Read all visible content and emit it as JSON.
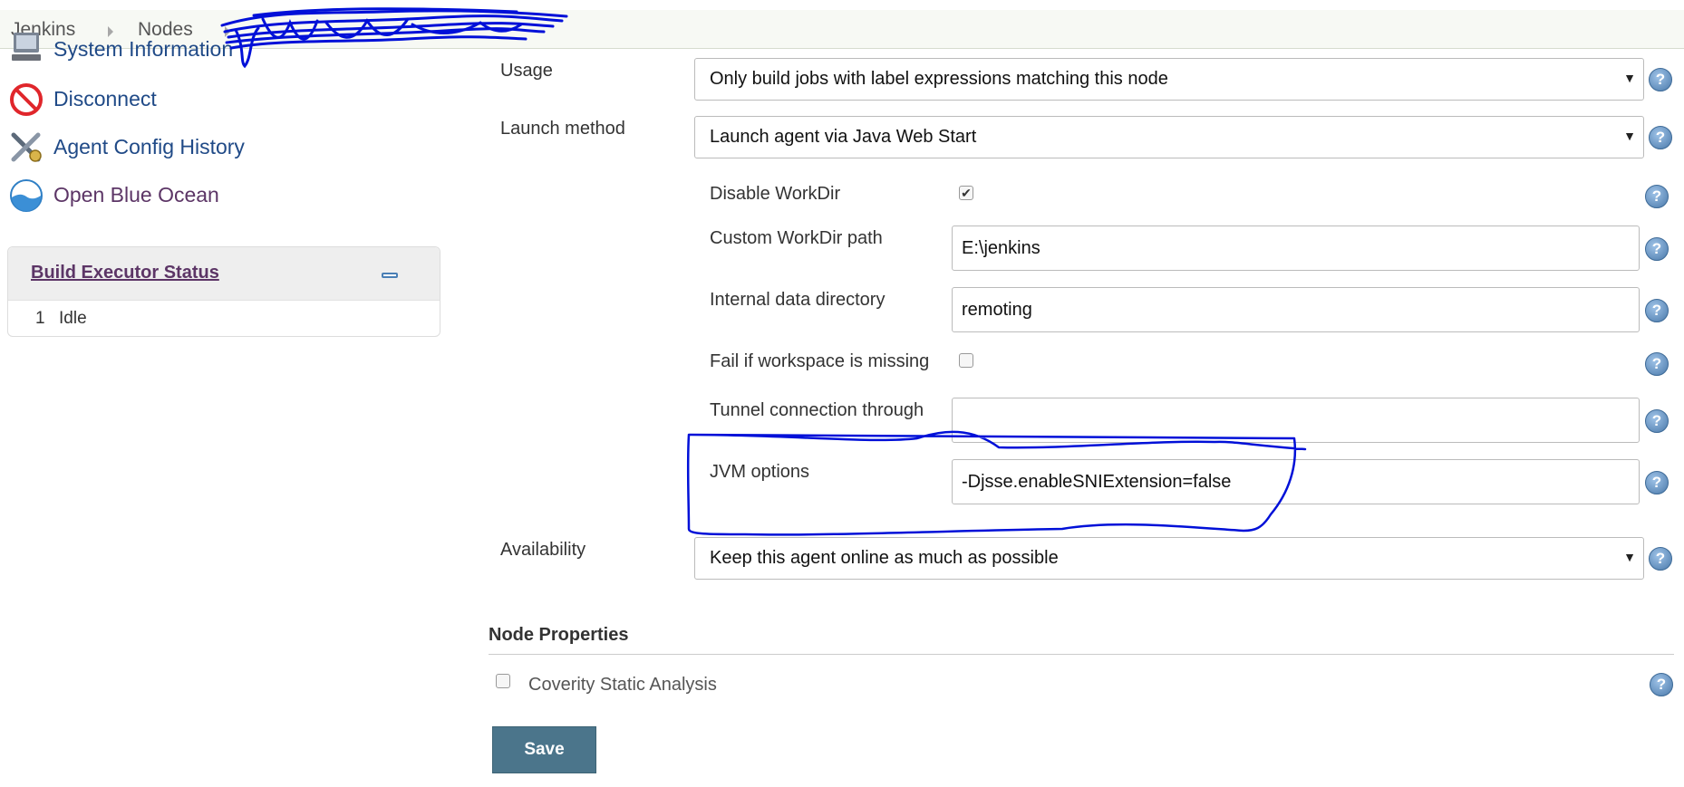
{
  "breadcrumb": {
    "items": [
      "Jenkins",
      "Nodes"
    ]
  },
  "sidebar": {
    "items": [
      {
        "label": "System Information",
        "icon": "computer-icon"
      },
      {
        "label": "Disconnect",
        "icon": "no-entry-icon"
      },
      {
        "label": "Agent Config History",
        "icon": "tools-icon"
      },
      {
        "label": "Open Blue Ocean",
        "icon": "blue-ocean-icon"
      }
    ]
  },
  "executors": {
    "title": "Build Executor Status",
    "rows": [
      {
        "number": "1",
        "state": "Idle"
      }
    ]
  },
  "form": {
    "usage": {
      "label": "Usage",
      "value": "Only build jobs with label expressions matching this node"
    },
    "launch_method": {
      "label": "Launch method",
      "value": "Launch agent via Java Web Start"
    },
    "disable_workdir": {
      "label": "Disable WorkDir",
      "checked": true
    },
    "custom_workdir": {
      "label": "Custom WorkDir path",
      "value": "E:\\jenkins"
    },
    "internal_data_dir": {
      "label": "Internal data directory",
      "value": "remoting"
    },
    "fail_if_missing": {
      "label": "Fail if workspace is missing",
      "checked": false
    },
    "tunnel": {
      "label": "Tunnel connection through",
      "value": ""
    },
    "jvm_options": {
      "label": "JVM options",
      "value": "-Djsse.enableSNIExtension=false"
    },
    "availability": {
      "label": "Availability",
      "value": "Keep this agent online as much as possible"
    }
  },
  "node_properties": {
    "title": "Node Properties",
    "coverity": {
      "label": "Coverity Static Analysis",
      "checked": false
    }
  },
  "help_glyph": "?",
  "dropdown_glyph": "▼",
  "checkmark_glyph": "✔",
  "save_label": "Save",
  "colors": {
    "link": "#204a87",
    "visited": "#5c3566",
    "save_button": "#4b758b",
    "annotation": "#0010d8"
  }
}
